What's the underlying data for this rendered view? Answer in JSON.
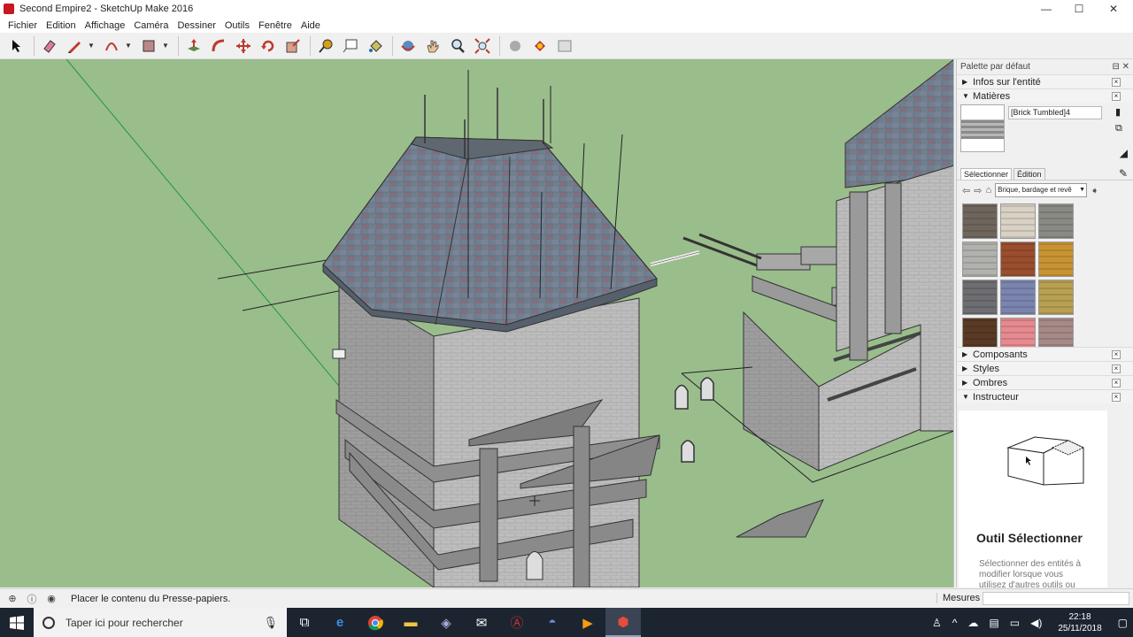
{
  "window": {
    "title": "Second Empire2 - SketchUp Make 2016",
    "controls": {
      "minimize": "—",
      "maximize": "☐",
      "close": "✕"
    }
  },
  "menu": [
    "Fichier",
    "Edition",
    "Affichage",
    "Caméra",
    "Dessiner",
    "Outils",
    "Fenêtre",
    "Aide"
  ],
  "toolbar": {
    "tools": [
      {
        "name": "select-tool",
        "icon": "arrow"
      },
      {
        "name": "eraser-tool",
        "icon": "eraser"
      },
      {
        "name": "line-tool",
        "icon": "pencil"
      },
      {
        "name": "arc-tool",
        "icon": "arc"
      },
      {
        "name": "shape-tool",
        "icon": "rectangle"
      },
      {
        "name": "push-pull-tool",
        "icon": "push-pull"
      },
      {
        "name": "follow-me-tool",
        "icon": "follow-me"
      },
      {
        "name": "move-tool",
        "icon": "move"
      },
      {
        "name": "rotate-tool",
        "icon": "rotate"
      },
      {
        "name": "scale-tool",
        "icon": "scale"
      },
      {
        "name": "tape-measure-tool",
        "icon": "tape"
      },
      {
        "name": "text-tool",
        "icon": "text"
      },
      {
        "name": "paint-bucket-tool",
        "icon": "paint"
      },
      {
        "name": "orbit-tool",
        "icon": "orbit"
      },
      {
        "name": "pan-tool",
        "icon": "hand"
      },
      {
        "name": "zoom-tool",
        "icon": "zoom"
      },
      {
        "name": "zoom-extents-tool",
        "icon": "zoom-extents"
      },
      {
        "name": "warehouse-tool",
        "icon": "3d-warehouse"
      },
      {
        "name": "extension-tool",
        "icon": "extension"
      },
      {
        "name": "layout-tool",
        "icon": "layout"
      }
    ]
  },
  "panel": {
    "title": "Palette par défaut",
    "sections": {
      "entity_info": "Infos sur l'entité",
      "materials": "Matières",
      "components": "Composants",
      "styles": "Styles",
      "shadows": "Ombres",
      "instructor": "Instructeur"
    },
    "material_name": "[Brick Tumbled]4",
    "tabs": [
      "Sélectionner",
      "Édition"
    ],
    "library": "Brique, bardage et revê",
    "swatches": [
      "#6e665c",
      "#d9d2c4",
      "#8a8a84",
      "#b1b1ad",
      "#9a4e2e",
      "#c89433",
      "#6d6d72",
      "#7b84ae",
      "#b8a053",
      "#5a3a24",
      "#e68a8f",
      "#a58a88"
    ],
    "instructor": {
      "title": "Outil Sélectionner",
      "description": "Sélectionner des entités à modifier lorsque vous utilisez d'autres outils ou"
    }
  },
  "status": {
    "message": "Placer le contenu du Presse-papiers.",
    "measure_label": "Mesures"
  },
  "taskbar": {
    "search_placeholder": "Taper ici pour rechercher",
    "time": "22:18",
    "date": "25/11/2018"
  }
}
